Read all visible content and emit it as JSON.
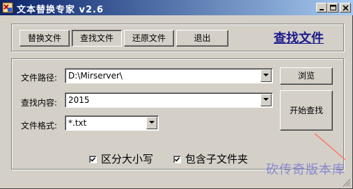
{
  "window": {
    "title": "文本替换专家 v2.6",
    "minimize_label": "",
    "maximize_label": "",
    "close_label": ""
  },
  "tabs": [
    {
      "label": "替换文件"
    },
    {
      "label": "查找文件"
    },
    {
      "label": "还原文件"
    },
    {
      "label": "退出"
    }
  ],
  "page_title": "查找文件",
  "form": {
    "path_label": "文件路径:",
    "path_value": "D:\\Mirserver\\",
    "content_label": "查找内容:",
    "content_value": "2015",
    "format_label": "文件格式:",
    "format_value": "*.txt"
  },
  "buttons": {
    "browse": "浏览",
    "start_search": "开始查找"
  },
  "options": {
    "case_sensitive": {
      "label": "区分大小写",
      "checked": true
    },
    "include_subfolders": {
      "label": "包含子文件夹",
      "checked": true
    }
  },
  "watermark": "砍传奇版本库",
  "colors": {
    "titlebar_start": "#0a246a",
    "titlebar_end": "#a6caf0",
    "title_link": "#1a1a8c",
    "watermark": "#7b7bd6",
    "annotation_line": "#ff6a5c"
  }
}
